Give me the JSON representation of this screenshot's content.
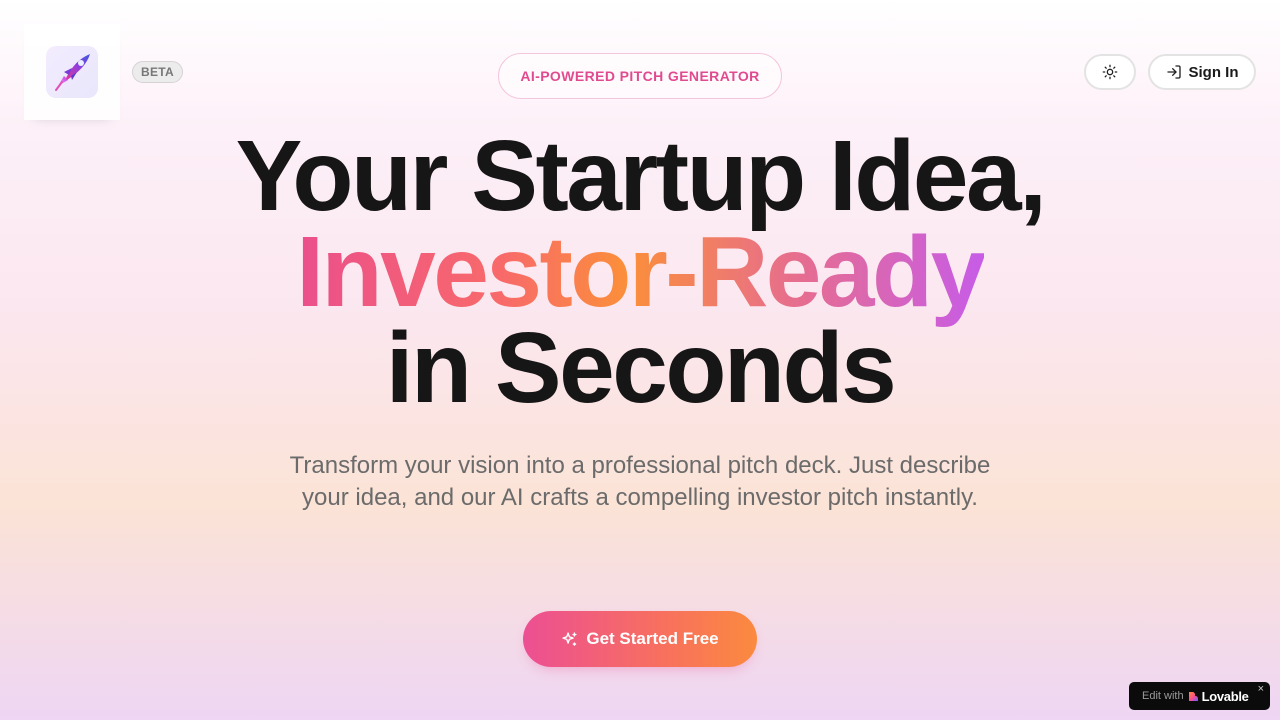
{
  "header": {
    "beta_label": "BETA",
    "pill_label": "AI-POWERED PITCH GENERATOR",
    "theme_toggle_icon": "sun-icon",
    "signin_label": "Sign In",
    "signin_icon": "sign-in-icon",
    "logo_icon": "rocket-icon"
  },
  "hero": {
    "line1": "Your Startup Idea,",
    "line2": "Investor-Ready",
    "line3": "in Seconds",
    "subtitle": "Transform your vision into a professional pitch deck. Just describe your idea, and our AI crafts a compelling investor pitch instantly."
  },
  "cta": {
    "label": "Get Started Free",
    "icon": "sparkles-icon"
  },
  "badge": {
    "edit_label": "Edit with",
    "brand_label": "Lovable",
    "close_label": "×"
  },
  "colors": {
    "accent_pink": "#ec4f93",
    "accent_orange": "#fb8a3f",
    "accent_purple": "#c75ce8",
    "heading": "#161616"
  }
}
